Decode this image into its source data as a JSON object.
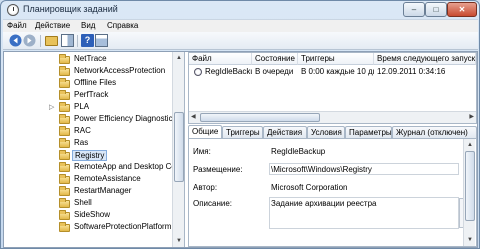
{
  "window": {
    "title": "Планировщик заданий",
    "controls": {
      "minimize": "–",
      "maximize": "□",
      "close": "✕"
    }
  },
  "menu": [
    "Файл",
    "Действие",
    "Вид",
    "Справка"
  ],
  "toolbar": {
    "icons": [
      "back-arrow-icon",
      "forward-arrow-icon",
      "folder-up-icon",
      "show-hide-tree-icon",
      "help-icon",
      "action-pane-icon"
    ]
  },
  "tree": {
    "items": [
      {
        "label": "NetTrace",
        "expandable": false,
        "selected": false
      },
      {
        "label": "NetworkAccessProtection",
        "expandable": false,
        "selected": false
      },
      {
        "label": "Offline Files",
        "expandable": false,
        "selected": false
      },
      {
        "label": "PerfTrack",
        "expandable": false,
        "selected": false
      },
      {
        "label": "PLA",
        "expandable": true,
        "selected": false
      },
      {
        "label": "Power Efficiency Diagnostics",
        "expandable": false,
        "selected": false
      },
      {
        "label": "RAC",
        "expandable": false,
        "selected": false
      },
      {
        "label": "Ras",
        "expandable": false,
        "selected": false
      },
      {
        "label": "Registry",
        "expandable": false,
        "selected": true
      },
      {
        "label": "RemoteApp and Desktop Co",
        "expandable": false,
        "selected": false
      },
      {
        "label": "RemoteAssistance",
        "expandable": false,
        "selected": false
      },
      {
        "label": "RestartManager",
        "expandable": false,
        "selected": false
      },
      {
        "label": "Shell",
        "expandable": false,
        "selected": false
      },
      {
        "label": "SideShow",
        "expandable": false,
        "selected": false
      },
      {
        "label": "SoftwareProtectionPlatform",
        "expandable": false,
        "selected": false
      }
    ],
    "expander_glyph": "▷"
  },
  "tasks": {
    "columns": [
      "Файл",
      "Состояние",
      "Триггеры",
      "Время следующего запуска"
    ],
    "rows": [
      [
        "RegIdleBackup",
        "В очереди",
        "В 0:00 каждые 10 дн.",
        "12.09.2011 0:34:16"
      ]
    ]
  },
  "details": {
    "tabs": [
      "Общие",
      "Триггеры",
      "Действия",
      "Условия",
      "Параметры",
      "Журнал (отключен)"
    ],
    "active_tab": "Общие",
    "fields": {
      "name_label": "Имя:",
      "name_value": "RegIdleBackup",
      "location_label": "Размещение:",
      "location_value": "\\Microsoft\\Windows\\Registry",
      "author_label": "Автор:",
      "author_value": "Microsoft Corporation",
      "description_label": "Описание:",
      "description_value": "Задание архивации реестра"
    }
  },
  "scroll_glyphs": {
    "up": "▲",
    "down": "▼",
    "left": "◀",
    "right": "▶"
  },
  "colors": {
    "selection": "#d9e7f8",
    "selection_border": "#84acdd",
    "close_button": "#c84a30"
  }
}
